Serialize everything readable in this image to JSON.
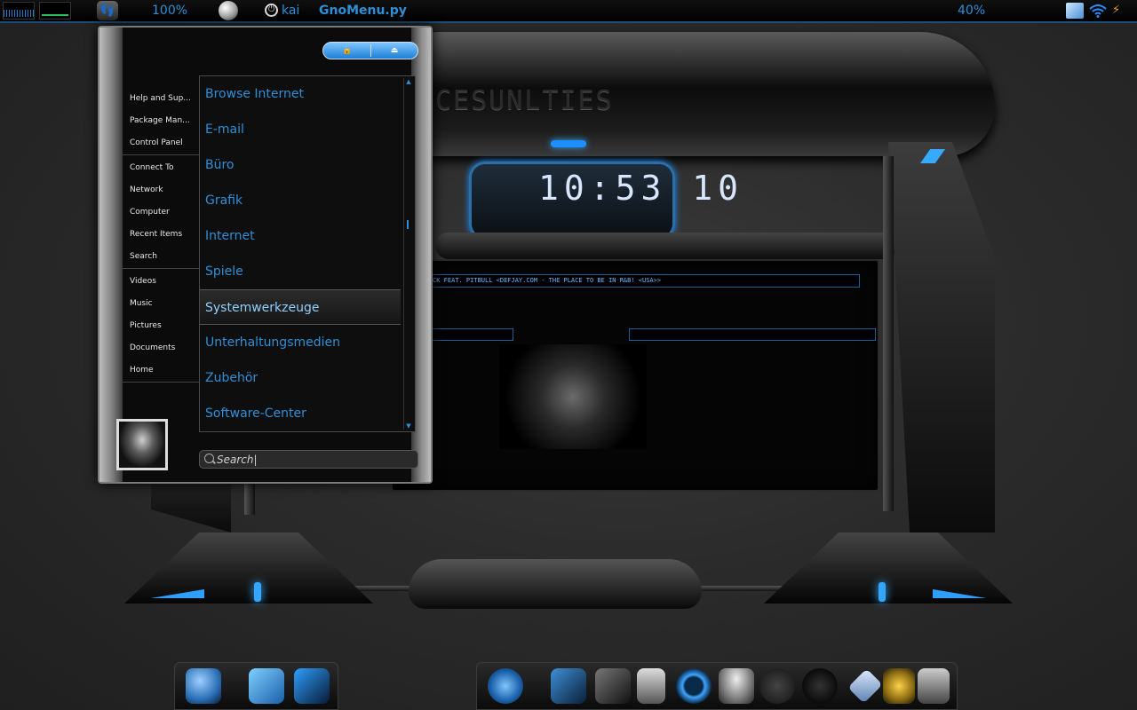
{
  "top_panel": {
    "brightness": "100%",
    "user": "kai",
    "app_title": "GnoMenu.py",
    "battery": "40%"
  },
  "wallpaper": {
    "hull_logo": "CESUNLTIES",
    "clock_digits": "10:53 10",
    "ticker": "CK FEAT. PITBULL <DEFJAY.COM - THE PLACE TO BE IN R&B! <USA>>"
  },
  "menu": {
    "places": [
      {
        "label": "Help and Sup..."
      },
      {
        "label": "Package Man..."
      },
      {
        "label": "Control Panel"
      },
      {
        "label": "Connect To"
      },
      {
        "label": "Network"
      },
      {
        "label": "Computer"
      },
      {
        "label": "Recent Items"
      },
      {
        "label": "Search"
      },
      {
        "label": "Videos"
      },
      {
        "label": "Music"
      },
      {
        "label": "Pictures"
      },
      {
        "label": "Documents"
      },
      {
        "label": "Home"
      }
    ],
    "categories": [
      {
        "label": "Browse Internet"
      },
      {
        "label": "E-mail"
      },
      {
        "label": "Büro"
      },
      {
        "label": "Grafik"
      },
      {
        "label": "Internet"
      },
      {
        "label": "Spiele"
      },
      {
        "label": "Systemwerkzeuge",
        "selected": true
      },
      {
        "label": "Unterhaltungsmedien"
      },
      {
        "label": "Zubehör"
      },
      {
        "label": "Software-Center"
      }
    ],
    "search": {
      "value": "Search|",
      "placeholder": "Search|"
    }
  },
  "dock_left": [
    "users-icon",
    "chat-icon",
    "folder-icon"
  ],
  "dock_right": [
    "firefox-icon",
    "monitor-icon",
    "folder-icon",
    "trash-icon",
    "quicktime-icon",
    "weather-icon",
    "gauges-icon",
    "clock-icon",
    "gem-icon",
    "media-icon",
    "settings-icon"
  ],
  "colors": {
    "accent": "#2f8fd6",
    "glow": "#34a6ff"
  }
}
